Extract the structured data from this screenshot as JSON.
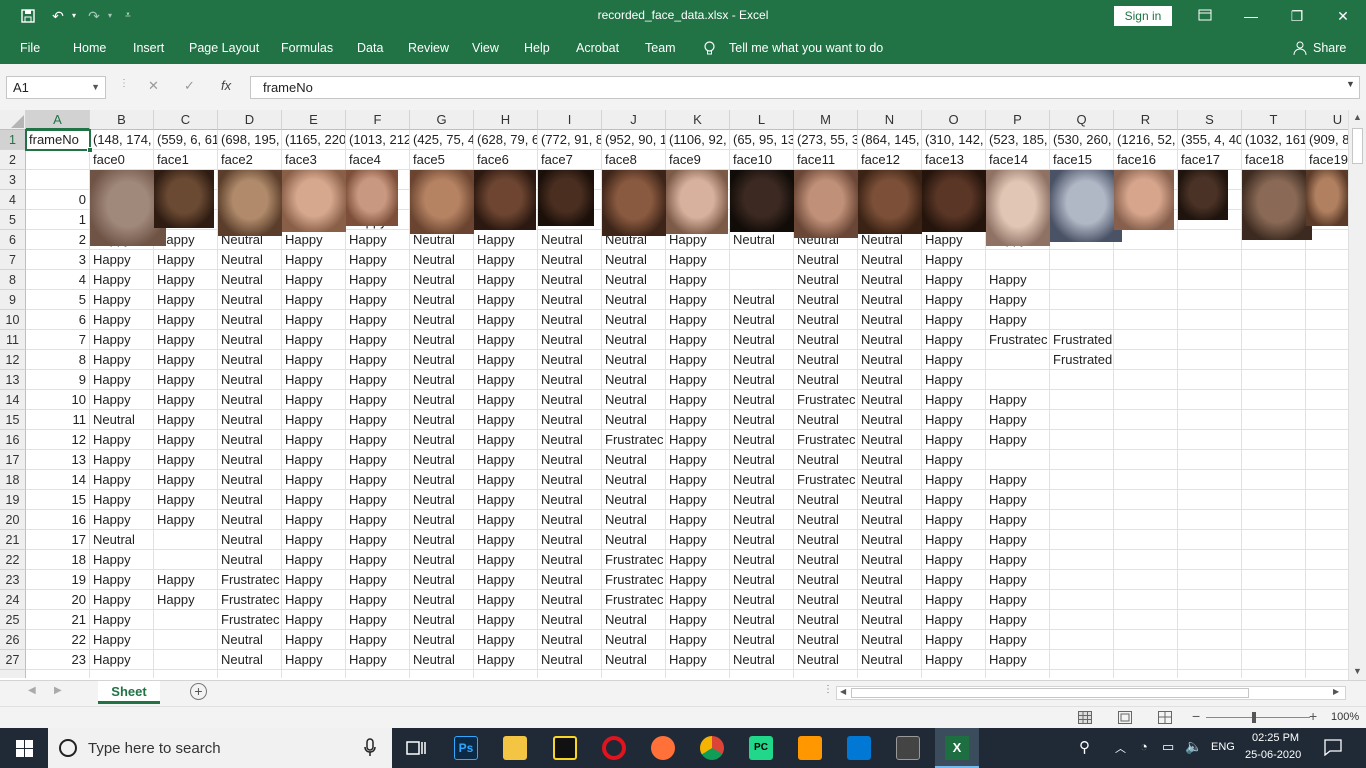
{
  "window": {
    "title": "recorded_face_data.xlsx  -  Excel",
    "sign_in": "Sign in"
  },
  "ribbon": {
    "tabs": [
      "File",
      "Home",
      "Insert",
      "Page Layout",
      "Formulas",
      "Data",
      "Review",
      "View",
      "Help",
      "Acrobat",
      "Team"
    ],
    "tell_me": "Tell me what you want to do",
    "share": "Share"
  },
  "formula_bar": {
    "name_box": "A1",
    "fx": "fx",
    "content": "frameNo"
  },
  "columns": [
    "A",
    "B",
    "C",
    "D",
    "E",
    "F",
    "G",
    "H",
    "I",
    "J",
    "K",
    "L",
    "M",
    "N",
    "O",
    "P",
    "Q",
    "R",
    "S",
    "T",
    "U"
  ],
  "rows": {
    "row_numbers": [
      "1",
      "2",
      "3",
      "4",
      "5",
      "6",
      "7",
      "8",
      "9",
      "10",
      "11",
      "12",
      "13",
      "14",
      "15",
      "16",
      "17",
      "18",
      "19",
      "20",
      "21",
      "22",
      "23",
      "24",
      "25",
      "26",
      "27"
    ],
    "row1": [
      "frameNo",
      "(148, 174,",
      "(559, 6, 61",
      "(698, 195,",
      "(1165, 220",
      "(1013, 212",
      "(425, 75, 4",
      "(628, 79, 6",
      "(772, 91, 8",
      "(952, 90, 1",
      "(1106, 92,",
      "(65, 95, 13",
      "(273, 55, 3",
      "(864, 145,",
      "(310, 142,",
      "(523, 185,",
      "(530, 260,",
      "(1216, 52,",
      "(355, 4, 40",
      "(1032, 161",
      "(909, 8"
    ],
    "row2": [
      "",
      "face0",
      "face1",
      "face2",
      "face3",
      "face4",
      "face5",
      "face6",
      "face7",
      "face8",
      "face9",
      "face10",
      "face11",
      "face12",
      "face13",
      "face14",
      "face15",
      "face16",
      "face17",
      "face18",
      "face19"
    ],
    "row4_frame": "0",
    "row5_frame": "1",
    "row6": [
      "2",
      "Happy",
      "Happy",
      "Neutral",
      "Happy",
      "Happy",
      "Neutral",
      "Happy",
      "Neutral",
      "Neutral",
      "Happy",
      "Neutral",
      "Neutral",
      "Neutral",
      "Happy",
      "Happy",
      "",
      "",
      "",
      "",
      ""
    ],
    "f_overlay": "Happy",
    "data": [
      [
        "3",
        "Happy",
        "Happy",
        "Neutral",
        "Happy",
        "Happy",
        "Neutral",
        "Happy",
        "Neutral",
        "Neutral",
        "Happy",
        "",
        "Neutral",
        "Neutral",
        "Happy",
        "",
        "",
        "",
        "",
        "",
        ""
      ],
      [
        "4",
        "Happy",
        "Happy",
        "Neutral",
        "Happy",
        "Happy",
        "Neutral",
        "Happy",
        "Neutral",
        "Neutral",
        "Happy",
        "",
        "Neutral",
        "Neutral",
        "Happy",
        "Happy",
        "",
        "",
        "",
        "",
        ""
      ],
      [
        "5",
        "Happy",
        "Happy",
        "Neutral",
        "Happy",
        "Happy",
        "Neutral",
        "Happy",
        "Neutral",
        "Neutral",
        "Happy",
        "Neutral",
        "Neutral",
        "Neutral",
        "Happy",
        "Happy",
        "",
        "",
        "",
        "",
        ""
      ],
      [
        "6",
        "Happy",
        "Happy",
        "Neutral",
        "Happy",
        "Happy",
        "Neutral",
        "Happy",
        "Neutral",
        "Neutral",
        "Happy",
        "Neutral",
        "Neutral",
        "Neutral",
        "Happy",
        "Happy",
        "",
        "",
        "",
        "",
        ""
      ],
      [
        "7",
        "Happy",
        "Happy",
        "Neutral",
        "Happy",
        "Happy",
        "Neutral",
        "Happy",
        "Neutral",
        "Neutral",
        "Happy",
        "Neutral",
        "Neutral",
        "Neutral",
        "Happy",
        "Frustratec",
        "Frustrated",
        "",
        "",
        "",
        ""
      ],
      [
        "8",
        "Happy",
        "Happy",
        "Neutral",
        "Happy",
        "Happy",
        "Neutral",
        "Happy",
        "Neutral",
        "Neutral",
        "Happy",
        "Neutral",
        "Neutral",
        "Neutral",
        "Happy",
        "",
        "Frustrated",
        "",
        "",
        "",
        ""
      ],
      [
        "9",
        "Happy",
        "Happy",
        "Neutral",
        "Happy",
        "Happy",
        "Neutral",
        "Happy",
        "Neutral",
        "Neutral",
        "Happy",
        "Neutral",
        "Neutral",
        "Neutral",
        "Happy",
        "",
        "",
        "",
        "",
        "",
        ""
      ],
      [
        "10",
        "Happy",
        "Happy",
        "Neutral",
        "Happy",
        "Happy",
        "Neutral",
        "Happy",
        "Neutral",
        "Neutral",
        "Happy",
        "Neutral",
        "Frustratec",
        "Neutral",
        "Happy",
        "Happy",
        "",
        "",
        "",
        "",
        ""
      ],
      [
        "11",
        "Neutral",
        "Happy",
        "Neutral",
        "Happy",
        "Happy",
        "Neutral",
        "Happy",
        "Neutral",
        "Neutral",
        "Happy",
        "Neutral",
        "Neutral",
        "Neutral",
        "Happy",
        "Happy",
        "",
        "",
        "",
        "",
        ""
      ],
      [
        "12",
        "Happy",
        "Happy",
        "Neutral",
        "Happy",
        "Happy",
        "Neutral",
        "Happy",
        "Neutral",
        "Frustratec",
        "Happy",
        "Neutral",
        "Frustratec",
        "Neutral",
        "Happy",
        "Happy",
        "",
        "",
        "",
        "",
        ""
      ],
      [
        "13",
        "Happy",
        "Happy",
        "Neutral",
        "Happy",
        "Happy",
        "Neutral",
        "Happy",
        "Neutral",
        "Neutral",
        "Happy",
        "Neutral",
        "Neutral",
        "Neutral",
        "Happy",
        "",
        "",
        "",
        "",
        "",
        ""
      ],
      [
        "14",
        "Happy",
        "Happy",
        "Neutral",
        "Happy",
        "Happy",
        "Neutral",
        "Happy",
        "Neutral",
        "Neutral",
        "Happy",
        "Neutral",
        "Frustratec",
        "Neutral",
        "Happy",
        "Happy",
        "",
        "",
        "",
        "",
        ""
      ],
      [
        "15",
        "Happy",
        "Happy",
        "Neutral",
        "Happy",
        "Happy",
        "Neutral",
        "Happy",
        "Neutral",
        "Neutral",
        "Happy",
        "Neutral",
        "Neutral",
        "Neutral",
        "Happy",
        "Happy",
        "",
        "",
        "",
        "",
        ""
      ],
      [
        "16",
        "Happy",
        "Happy",
        "Neutral",
        "Happy",
        "Happy",
        "Neutral",
        "Happy",
        "Neutral",
        "Neutral",
        "Happy",
        "Neutral",
        "Neutral",
        "Neutral",
        "Happy",
        "Happy",
        "",
        "",
        "",
        "",
        ""
      ],
      [
        "17",
        "Neutral",
        "",
        "Neutral",
        "Happy",
        "Happy",
        "Neutral",
        "Happy",
        "Neutral",
        "Neutral",
        "Happy",
        "Neutral",
        "Neutral",
        "Neutral",
        "Happy",
        "Happy",
        "",
        "",
        "",
        "",
        ""
      ],
      [
        "18",
        "Happy",
        "",
        "Neutral",
        "Happy",
        "Happy",
        "Neutral",
        "Happy",
        "Neutral",
        "Frustratec",
        "Happy",
        "Neutral",
        "Neutral",
        "Neutral",
        "Happy",
        "Happy",
        "",
        "",
        "",
        "",
        ""
      ],
      [
        "19",
        "Happy",
        "Happy",
        "Frustratec",
        "Happy",
        "Happy",
        "Neutral",
        "Happy",
        "Neutral",
        "Frustratec",
        "Happy",
        "Neutral",
        "Neutral",
        "Neutral",
        "Happy",
        "Happy",
        "",
        "",
        "",
        "",
        ""
      ],
      [
        "20",
        "Happy",
        "Happy",
        "Frustratec",
        "Happy",
        "Happy",
        "Neutral",
        "Happy",
        "Neutral",
        "Frustratec",
        "Happy",
        "Neutral",
        "Neutral",
        "Neutral",
        "Happy",
        "Happy",
        "",
        "",
        "",
        "",
        ""
      ],
      [
        "21",
        "Happy",
        "",
        "Frustratec",
        "Happy",
        "Happy",
        "Neutral",
        "Happy",
        "Neutral",
        "Neutral",
        "Happy",
        "Neutral",
        "Neutral",
        "Neutral",
        "Happy",
        "Happy",
        "",
        "",
        "",
        "",
        ""
      ],
      [
        "22",
        "Happy",
        "",
        "Neutral",
        "Happy",
        "Happy",
        "Neutral",
        "Happy",
        "Neutral",
        "Neutral",
        "Happy",
        "Neutral",
        "Neutral",
        "Neutral",
        "Happy",
        "Happy",
        "",
        "",
        "",
        "",
        ""
      ],
      [
        "23",
        "Happy",
        "",
        "Neutral",
        "Happy",
        "Happy",
        "Neutral",
        "Happy",
        "Neutral",
        "Neutral",
        "Happy",
        "Neutral",
        "Neutral",
        "Neutral",
        "Happy",
        "Happy",
        "",
        "",
        "",
        "",
        ""
      ]
    ]
  },
  "sheet_tabs": [
    "Sheet"
  ],
  "status": {
    "zoom": "100%"
  },
  "taskbar": {
    "search_placeholder": "Type here to search",
    "time": "02:25 PM",
    "date": "25-06-2020",
    "lang": "ENG"
  },
  "colors": {
    "excel_green": "#217346",
    "taskbar_bg": "#1f2a36"
  }
}
